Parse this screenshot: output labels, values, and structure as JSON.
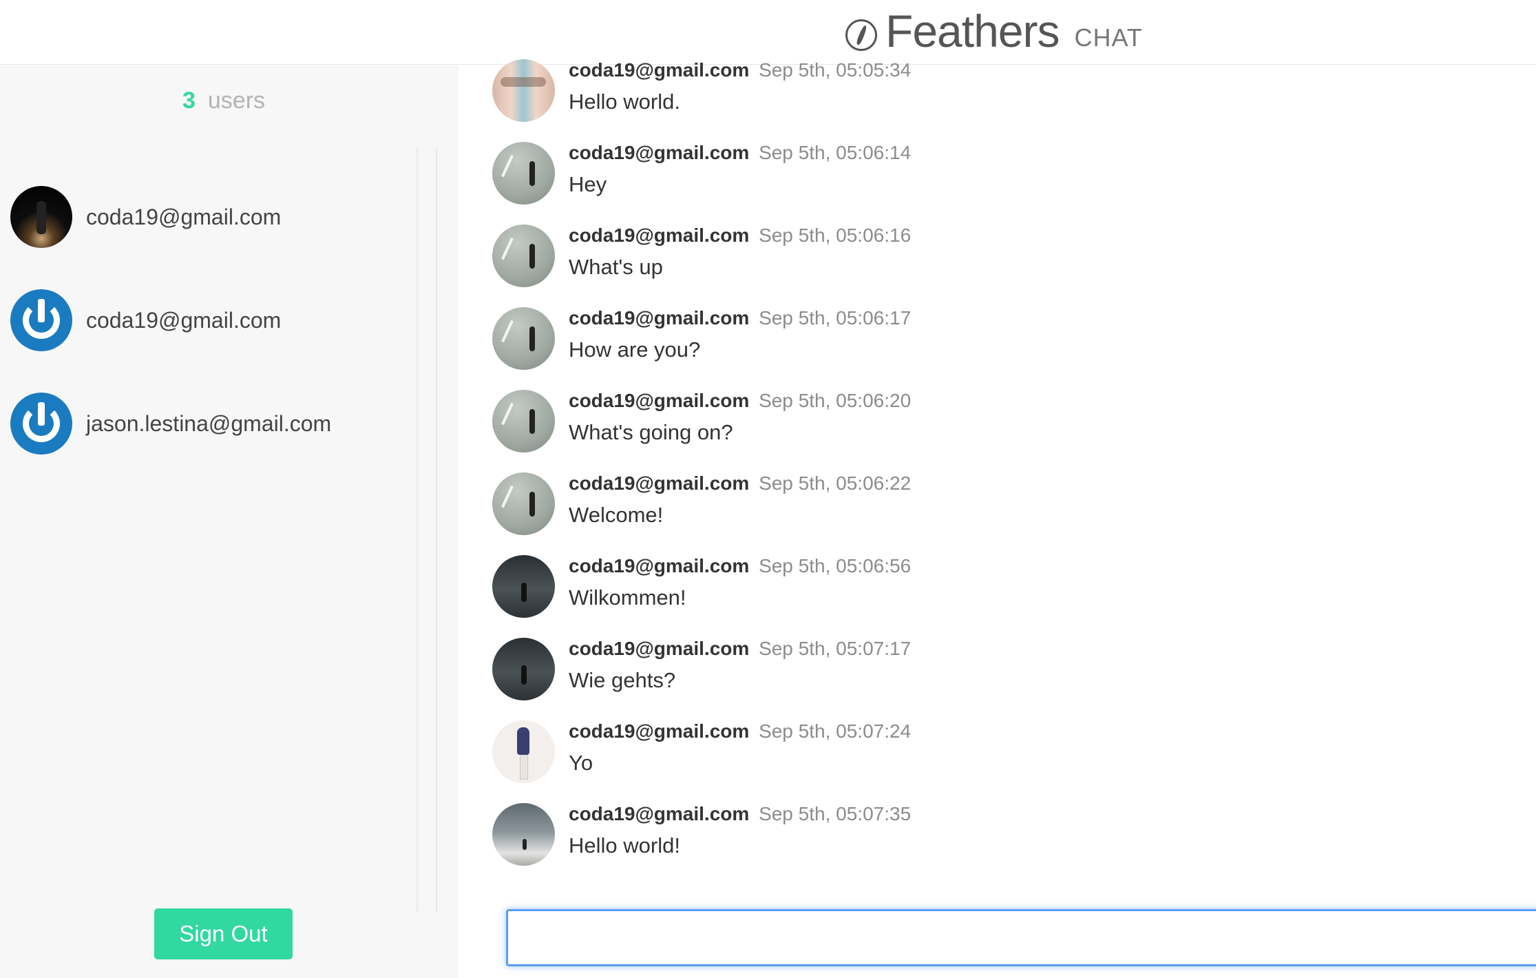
{
  "header": {
    "app_title": "Feathers",
    "app_subtitle": "CHAT",
    "logo_icon": "feather-icon"
  },
  "sidebar": {
    "user_count": "3",
    "user_count_label": "users",
    "users": [
      {
        "email": "coda19@gmail.com",
        "avatar": "night-scene-photo"
      },
      {
        "email": "coda19@gmail.com",
        "avatar": "power-icon"
      },
      {
        "email": "jason.lestina@gmail.com",
        "avatar": "power-icon"
      }
    ],
    "signout_label": "Sign Out"
  },
  "messages": [
    {
      "author": "coda19@gmail.com",
      "time": "Sep 5th, 05:05:34",
      "text": "Hello world.",
      "avatar": "faces-photo"
    },
    {
      "author": "coda19@gmail.com",
      "time": "Sep 5th, 05:06:14",
      "text": "Hey",
      "avatar": "walker-photo"
    },
    {
      "author": "coda19@gmail.com",
      "time": "Sep 5th, 05:06:16",
      "text": "What's up",
      "avatar": "walker-photo"
    },
    {
      "author": "coda19@gmail.com",
      "time": "Sep 5th, 05:06:17",
      "text": "How are you?",
      "avatar": "walker-photo"
    },
    {
      "author": "coda19@gmail.com",
      "time": "Sep 5th, 05:06:20",
      "text": "What's going on?",
      "avatar": "walker-photo"
    },
    {
      "author": "coda19@gmail.com",
      "time": "Sep 5th, 05:06:22",
      "text": "Welcome!",
      "avatar": "walker-photo"
    },
    {
      "author": "coda19@gmail.com",
      "time": "Sep 5th, 05:06:56",
      "text": "Wilkommen!",
      "avatar": "hallway-photo"
    },
    {
      "author": "coda19@gmail.com",
      "time": "Sep 5th, 05:07:17",
      "text": "Wie gehts?",
      "avatar": "hallway-photo"
    },
    {
      "author": "coda19@gmail.com",
      "time": "Sep 5th, 05:07:24",
      "text": "Yo",
      "avatar": "dancer-photo"
    },
    {
      "author": "coda19@gmail.com",
      "time": "Sep 5th, 05:07:35",
      "text": "Hello world!",
      "avatar": "wall-photo"
    }
  ],
  "compose": {
    "value": "",
    "focused": true
  },
  "colors": {
    "accent": "#31d8a0",
    "focus_ring": "#5b9df2",
    "sidebar_bg": "#f7f7f7",
    "power_blue": "#1b7bc0"
  }
}
